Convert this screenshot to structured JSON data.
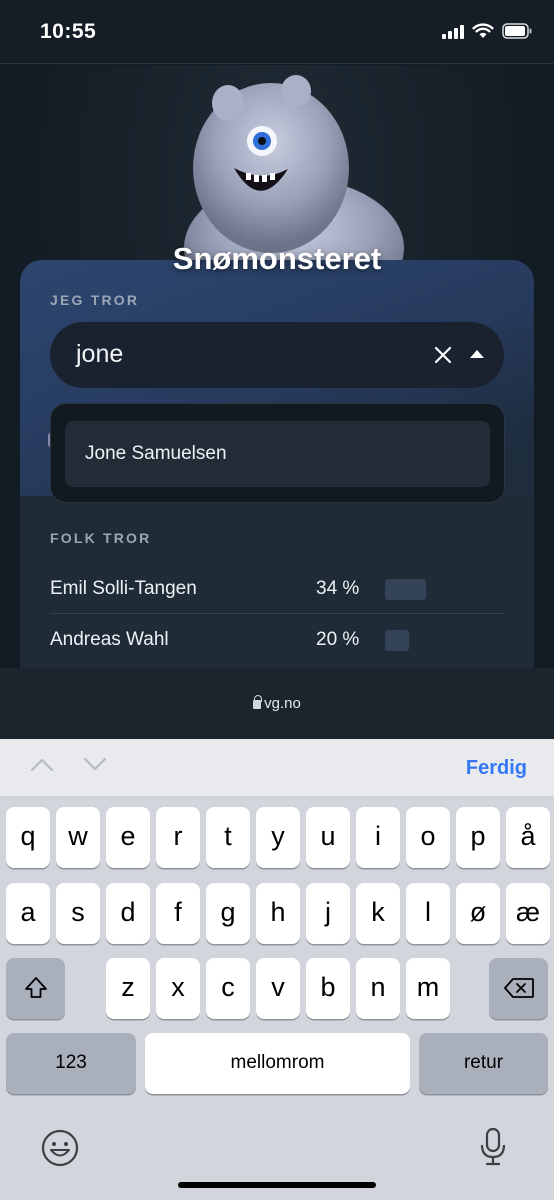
{
  "status_bar": {
    "time": "10:55"
  },
  "page": {
    "contestant_name": "Snømonsteret",
    "guess_section": {
      "label": "JEG TROR",
      "search_value": "jone",
      "suggestions": [
        "Jone Samuelsen"
      ]
    },
    "folk_section": {
      "label": "FOLK TROR",
      "results": [
        {
          "name": "Emil Solli-Tangen",
          "percent_text": "34 %",
          "percent": 34
        },
        {
          "name": "Andreas Wahl",
          "percent_text": "20 %",
          "percent": 20
        }
      ]
    }
  },
  "browser": {
    "url": "vg.no"
  },
  "keyboard": {
    "done_label": "Ferdig",
    "row1": [
      "q",
      "w",
      "e",
      "r",
      "t",
      "y",
      "u",
      "i",
      "o",
      "p",
      "å"
    ],
    "row2": [
      "a",
      "s",
      "d",
      "f",
      "g",
      "h",
      "j",
      "k",
      "l",
      "ø",
      "æ"
    ],
    "row3": [
      "z",
      "x",
      "c",
      "v",
      "b",
      "n",
      "m"
    ],
    "numbers_label": "123",
    "space_label": "mellomrom",
    "return_label": "retur"
  },
  "colors": {
    "accent": "#3478f6",
    "page_background": "#131c24"
  }
}
